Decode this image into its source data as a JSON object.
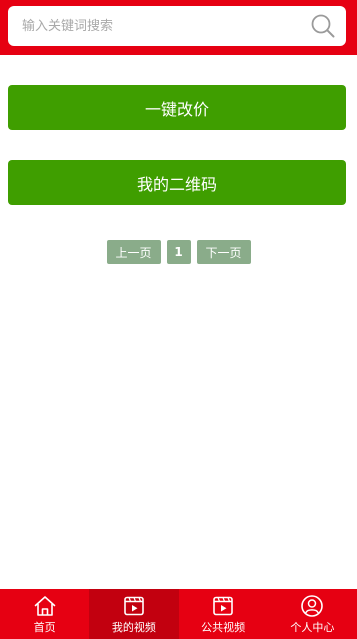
{
  "search": {
    "placeholder": "输入关键词搜索",
    "value": ""
  },
  "actions": {
    "change_price_label": "一键改价",
    "qrcode_label": "我的二维码"
  },
  "pagination": {
    "prev_label": "上一页",
    "current_page": "1",
    "next_label": "下一页"
  },
  "tabbar": {
    "tabs": [
      {
        "label": "首页",
        "icon": "home-icon",
        "active": false
      },
      {
        "label": "我的视频",
        "icon": "video-icon",
        "active": true
      },
      {
        "label": "公共视频",
        "icon": "video-icon",
        "active": false
      },
      {
        "label": "个人中心",
        "icon": "user-icon",
        "active": false
      }
    ]
  },
  "colors": {
    "brand_red": "#e60012",
    "active_tab": "#c2000f",
    "action_green": "#3f9e00",
    "page_button": "#8aac8a"
  }
}
